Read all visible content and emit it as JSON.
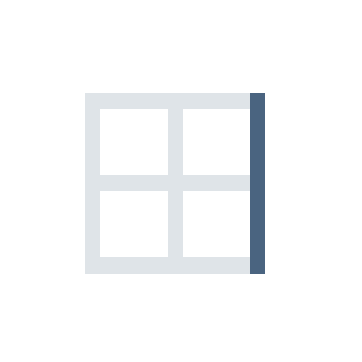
{
  "icon": {
    "name": "border-right-icon",
    "colors": {
      "background": "#ffffff",
      "grid": "#dfe4e8",
      "accent_border": "#4a6480"
    }
  }
}
